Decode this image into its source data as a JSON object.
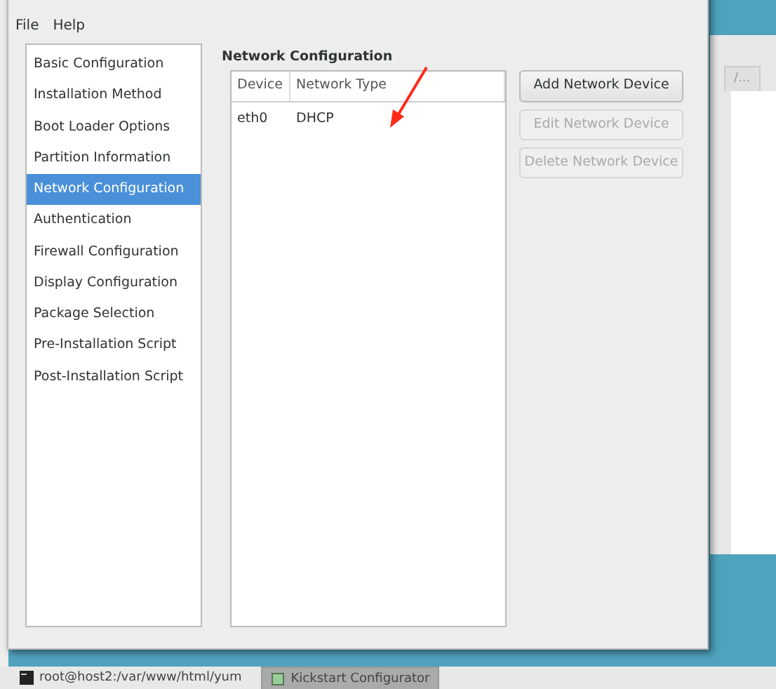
{
  "menu": [
    "File",
    "Help"
  ],
  "sidebar": {
    "items": [
      {
        "label": "Basic Configuration",
        "selected": false
      },
      {
        "label": "Installation Method",
        "selected": false
      },
      {
        "label": "Boot Loader Options",
        "selected": false
      },
      {
        "label": "Partition Information",
        "selected": false
      },
      {
        "label": "Network Configuration",
        "selected": true
      },
      {
        "label": "Authentication",
        "selected": false
      },
      {
        "label": "Firewall Configuration",
        "selected": false
      },
      {
        "label": "Display Configuration",
        "selected": false
      },
      {
        "label": "Package Selection",
        "selected": false
      },
      {
        "label": "Pre-Installation Script",
        "selected": false
      },
      {
        "label": "Post-Installation Script",
        "selected": false
      }
    ]
  },
  "section_title": "Network Configuration",
  "table": {
    "columns": [
      "Device",
      "Network Type"
    ],
    "rows": [
      [
        "eth0",
        "DHCP"
      ]
    ]
  },
  "buttons": [
    {
      "label": "Add Network Device",
      "disabled": false
    },
    {
      "label": "Edit Network Device",
      "disabled": true
    },
    {
      "label": "Delete Network Device",
      "disabled": true
    }
  ],
  "background_window": {
    "tab": "/..."
  },
  "taskbar": [
    {
      "label": "root@host2:/var/www/html/yum",
      "selected": false
    },
    {
      "label": "Kickstart Configurator",
      "selected": true
    }
  ]
}
